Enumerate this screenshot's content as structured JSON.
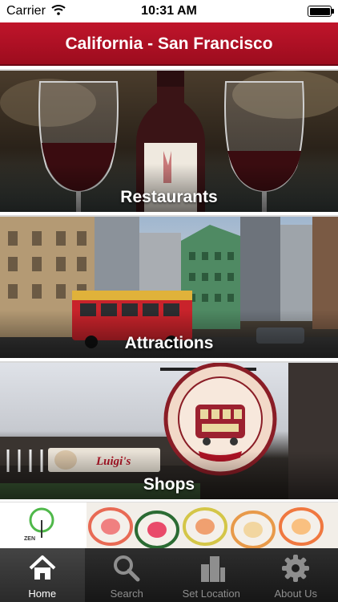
{
  "status_bar": {
    "carrier": "Carrier",
    "time": "10:31 AM"
  },
  "header": {
    "title": "California - San Francisco"
  },
  "categories": [
    {
      "label": "Restaurants"
    },
    {
      "label": "Attractions"
    },
    {
      "label": "Shops"
    }
  ],
  "banner": {
    "logo_text": "ZEN"
  },
  "tabs": [
    {
      "label": "Home",
      "icon": "home-icon"
    },
    {
      "label": "Search",
      "icon": "search-icon"
    },
    {
      "label": "Set Location",
      "icon": "buildings-icon"
    },
    {
      "label": "About Us",
      "icon": "gear-icon"
    }
  ],
  "colors": {
    "header": "#b01325",
    "tab_bar": "#1f1f1f"
  }
}
